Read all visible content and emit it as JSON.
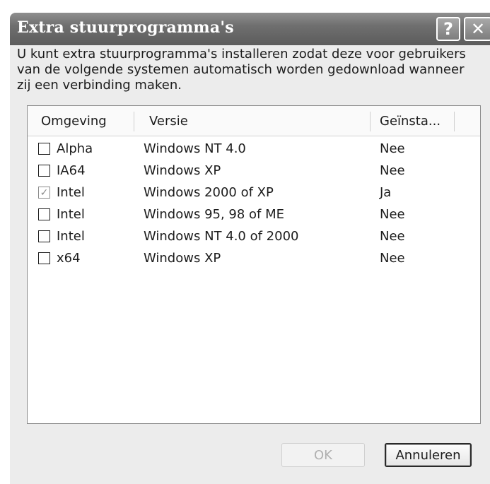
{
  "dialog": {
    "title": "Extra stuurprogramma's",
    "help_glyph": "?",
    "close_glyph": "✕",
    "description": "U kunt extra stuurprogramma's installeren zodat deze voor gebruikers van de volgende systemen automatisch worden gedownload wanneer zij een verbinding maken."
  },
  "table": {
    "columns": [
      "Omgeving",
      "Versie",
      "Geïnsta..."
    ],
    "rows": [
      {
        "checked": false,
        "environment": "Alpha",
        "version": "Windows NT 4.0",
        "installed": "Nee"
      },
      {
        "checked": false,
        "environment": "IA64",
        "version": "Windows XP",
        "installed": "Nee"
      },
      {
        "checked": true,
        "environment": "Intel",
        "version": "Windows 2000 of XP",
        "installed": "Ja"
      },
      {
        "checked": false,
        "environment": "Intel",
        "version": "Windows 95, 98 of ME",
        "installed": "Nee"
      },
      {
        "checked": false,
        "environment": "Intel",
        "version": "Windows NT 4.0 of 2000",
        "installed": "Nee"
      },
      {
        "checked": false,
        "environment": "x64",
        "version": "Windows XP",
        "installed": "Nee"
      }
    ]
  },
  "buttons": {
    "ok_label": "OK",
    "ok_enabled": false,
    "cancel_label": "Annuleren"
  },
  "icons": {
    "help": "help-question-icon",
    "close": "close-x-icon",
    "check": "checkmark-icon"
  }
}
